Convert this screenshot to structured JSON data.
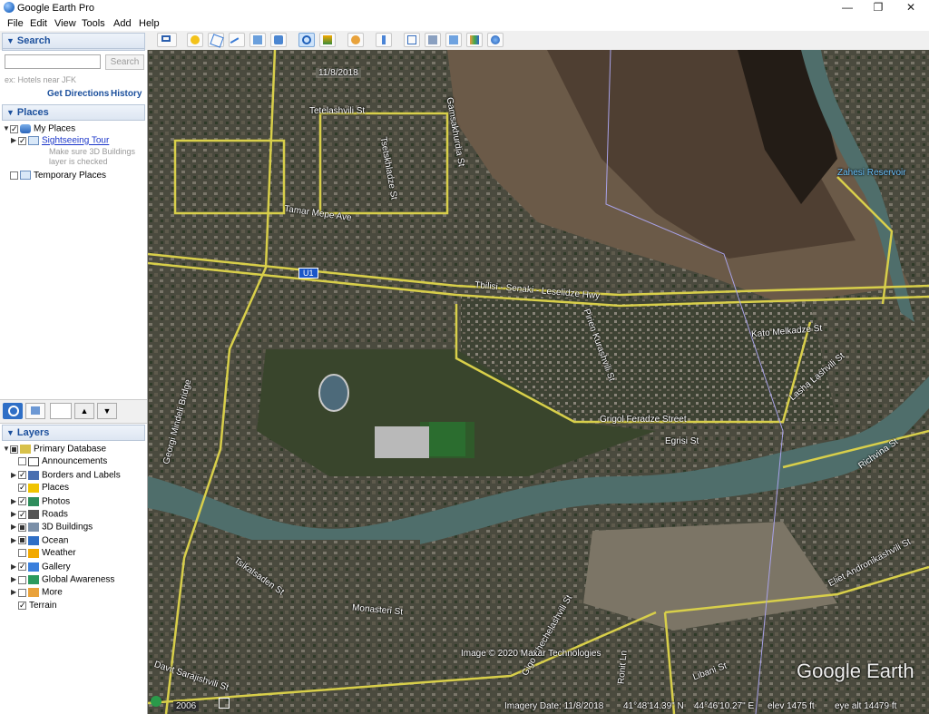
{
  "window": {
    "title": "Google Earth Pro",
    "minimize": "—",
    "maximize": "❐",
    "close": "✕"
  },
  "menu": [
    "File",
    "Edit",
    "View",
    "Tools",
    "Add",
    "Help"
  ],
  "search": {
    "header": "Search",
    "placeholder": "",
    "button": "Search",
    "hint": "ex: Hotels near JFK",
    "get_directions": "Get Directions",
    "history": "History"
  },
  "places": {
    "header": "Places",
    "my_places": "My Places",
    "sightseeing_tour": "Sightseeing Tour",
    "tour_note_1": "Make sure 3D Buildings",
    "tour_note_2": "layer is checked",
    "temporary_places": "Temporary Places"
  },
  "layers": {
    "header": "Layers",
    "items": [
      {
        "label": "Primary Database",
        "state": "part",
        "icon": "database-icon"
      },
      {
        "label": "Announcements",
        "state": "off",
        "icon": "envelope-icon"
      },
      {
        "label": "Borders and Labels",
        "state": "on",
        "icon": "flag-icon"
      },
      {
        "label": "Places",
        "state": "on",
        "icon": "places-icon"
      },
      {
        "label": "Photos",
        "state": "on",
        "icon": "photo-icon"
      },
      {
        "label": "Roads",
        "state": "on",
        "icon": "road-icon"
      },
      {
        "label": "3D Buildings",
        "state": "part",
        "icon": "buildings-icon"
      },
      {
        "label": "Ocean",
        "state": "part",
        "icon": "ocean-icon"
      },
      {
        "label": "Weather",
        "state": "off",
        "icon": "weather-icon"
      },
      {
        "label": "Gallery",
        "state": "on",
        "icon": "gallery-icon"
      },
      {
        "label": "Global Awareness",
        "state": "off",
        "icon": "globe-icon"
      },
      {
        "label": "More",
        "state": "off",
        "icon": "more-icon"
      },
      {
        "label": "Terrain",
        "state": "on",
        "icon": ""
      }
    ]
  },
  "map": {
    "date_badge": "11/8/2018",
    "road_labels": [
      "Tetelashvili St",
      "Gamsakhurdia St",
      "Tamar Mepe Ave",
      "Tsetskhladze St",
      "Tbilisi - Senaki - Leselidze Hwy",
      "Kato Melkadze St",
      "Pirien Kurashvili St",
      "Grigol Feradze Street",
      "Egrisi St",
      "Lasha Lashvili St",
      "Georgi Mindeli Bridge",
      "Tsikalsaden St",
      "Monasteri St",
      "Gigo Chechelashvili St",
      "Ronit Ln",
      "Libani St",
      "Davit Sarajishvili St",
      "Eliet Andronikashvili St",
      "Richvina St",
      "Zahesi Reservoir"
    ],
    "shield": "U1",
    "copyright": "Image © 2020 Maxar Technologies",
    "watermark": "Google Earth",
    "timeline_year": "2006",
    "imagery_date": "Imagery Date: 11/8/2018",
    "lat": "41°48'14.39\" N",
    "lon": "44°46'10.27\" E",
    "elev": "elev  1475 ft",
    "eye_alt": "eye alt  14479 ft"
  }
}
